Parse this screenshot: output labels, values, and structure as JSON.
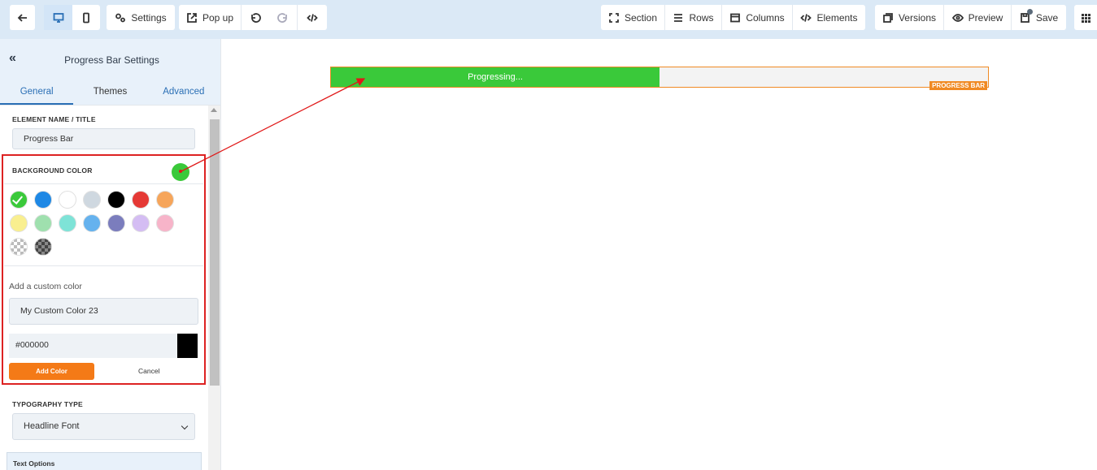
{
  "toolbar": {
    "settings_label": "Settings",
    "popup_label": "Pop up",
    "section_label": "Section",
    "rows_label": "Rows",
    "columns_label": "Columns",
    "elements_label": "Elements",
    "versions_label": "Versions",
    "preview_label": "Preview",
    "save_label": "Save"
  },
  "panel": {
    "title": "Progress Bar Settings",
    "tabs": [
      {
        "label": "General"
      },
      {
        "label": "Themes"
      },
      {
        "label": "Advanced"
      }
    ],
    "element_name_label": "ELEMENT NAME / TITLE",
    "element_name_value": "Progress Bar",
    "background_color_label": "BACKGROUND COLOR",
    "selected_color": "#3ac93a",
    "swatches": [
      "#3ac93a",
      "#1e88e5",
      "#ffffff",
      "#cfd8e0",
      "#000000",
      "#e53935",
      "#f6a55a",
      "#f9ef8f",
      "#9fe0ae",
      "#7ee3d7",
      "#65b2ee",
      "#7b7dbd",
      "#d4bdf3",
      "#f7b4c9"
    ],
    "custom_color_label": "Add a custom color",
    "custom_color_name": "My Custom Color 23",
    "custom_color_hex": "#000000",
    "add_color_label": "Add Color",
    "cancel_label": "Cancel",
    "typography_label": "TYPOGRAPHY TYPE",
    "typography_value": "Headline Font",
    "text_options_label": "Text Options"
  },
  "canvas": {
    "progress_text": "Progressing...",
    "progress_percent": 50,
    "progress_tag": "PROGRESS BAR",
    "accent_color": "#f08a24"
  }
}
